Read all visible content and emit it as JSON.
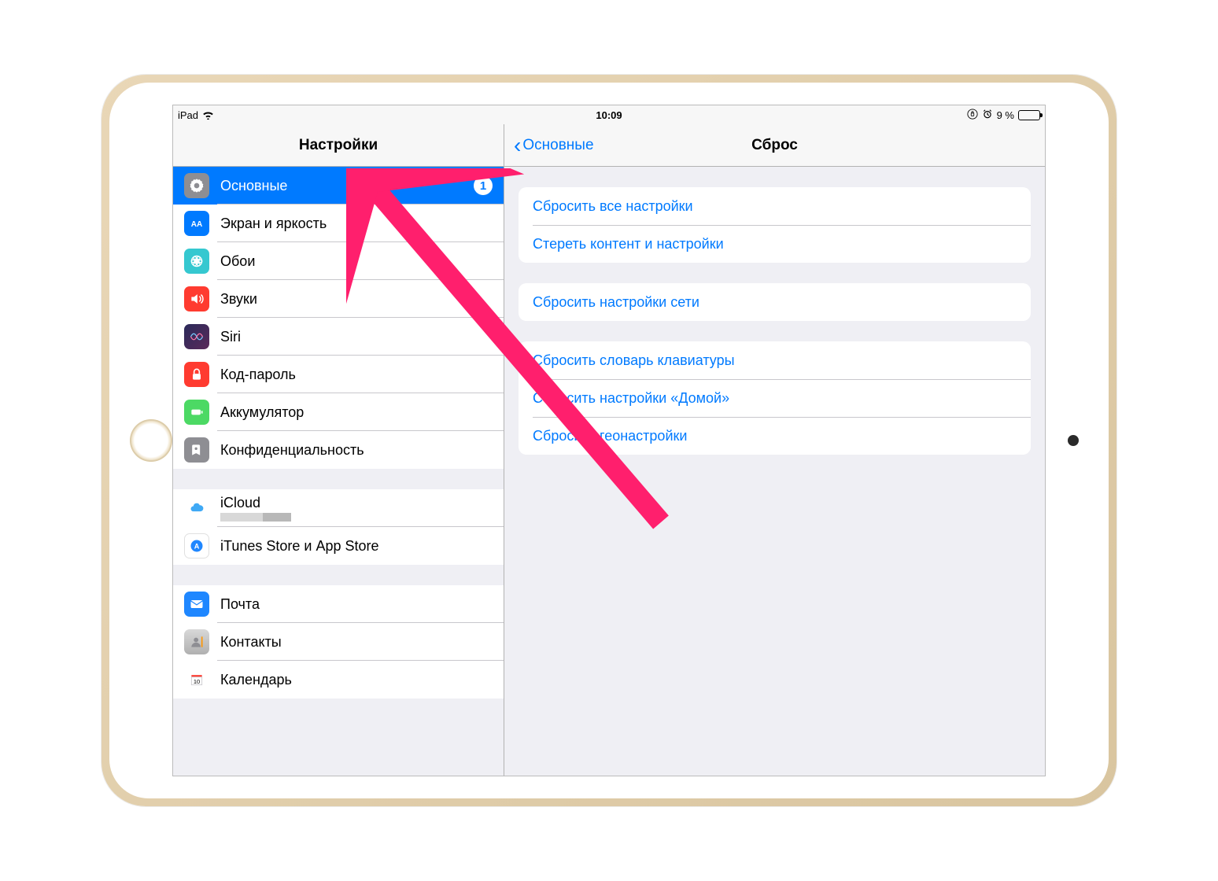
{
  "statusbar": {
    "device": "iPad",
    "time": "10:09",
    "battery": "9 %"
  },
  "sidebar": {
    "title": "Настройки",
    "groups": [
      [
        {
          "id": "general",
          "label": "Основные",
          "badge": "1",
          "selected": true,
          "icon": "gear-icon"
        },
        {
          "id": "display",
          "label": "Экран и яркость",
          "icon": "display-icon"
        },
        {
          "id": "wallpaper",
          "label": "Обои",
          "icon": "wallpaper-icon"
        },
        {
          "id": "sounds",
          "label": "Звуки",
          "icon": "sounds-icon"
        },
        {
          "id": "siri",
          "label": "Siri",
          "icon": "siri-icon"
        },
        {
          "id": "passcode",
          "label": "Код-пароль",
          "icon": "passcode-icon"
        },
        {
          "id": "battery",
          "label": "Аккумулятор",
          "icon": "battery-icon"
        },
        {
          "id": "privacy",
          "label": "Конфиденциальность",
          "icon": "privacy-icon"
        }
      ],
      [
        {
          "id": "icloud",
          "label": "iCloud",
          "icon": "icloud-icon",
          "hasSub": true
        },
        {
          "id": "itunes",
          "label": "iTunes Store и App Store",
          "icon": "appstore-icon"
        }
      ],
      [
        {
          "id": "mail",
          "label": "Почта",
          "icon": "mail-icon"
        },
        {
          "id": "contacts",
          "label": "Контакты",
          "icon": "contacts-icon"
        },
        {
          "id": "calendar",
          "label": "Календарь",
          "icon": "calendar-icon"
        }
      ]
    ]
  },
  "main": {
    "back": "Основные",
    "title": "Сброс",
    "groups": [
      [
        {
          "id": "reset-all",
          "label": "Сбросить все настройки"
        },
        {
          "id": "erase-all",
          "label": "Стереть контент и настройки"
        }
      ],
      [
        {
          "id": "reset-network",
          "label": "Сбросить настройки сети"
        }
      ],
      [
        {
          "id": "reset-keyboard",
          "label": "Сбросить словарь клавиатуры"
        },
        {
          "id": "reset-home",
          "label": "Сбросить настройки «Домой»"
        },
        {
          "id": "reset-location",
          "label": "Сбросить геонастройки"
        }
      ]
    ]
  }
}
